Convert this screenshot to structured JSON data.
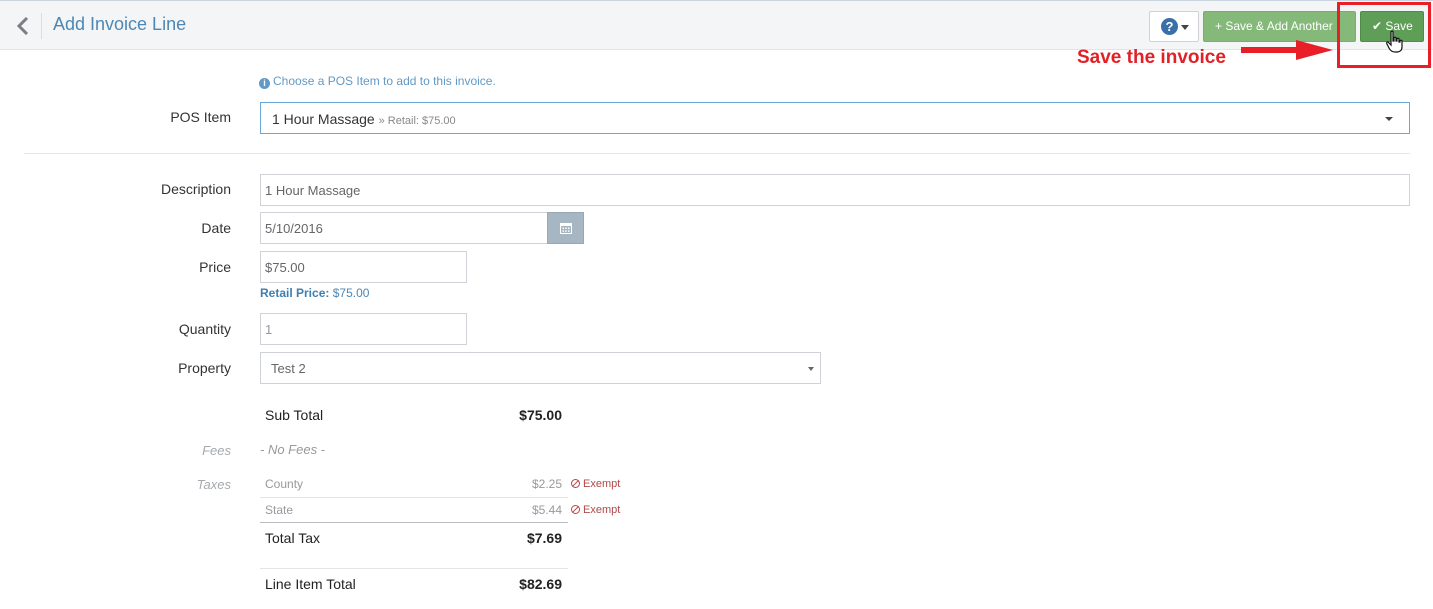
{
  "header": {
    "title": "Add Invoice Line",
    "help_icon": "question-circle-icon",
    "save_add_label": "+ Save & Add Another",
    "save_label": "✔ Save"
  },
  "annotation": {
    "text": "Save the invoice",
    "color": "#e81f27"
  },
  "form": {
    "info_text": "Choose a POS Item to add to this invoice.",
    "pos_item": {
      "label": "POS Item",
      "value": "1 Hour Massage",
      "retail_suffix": "» Retail: $75.00"
    },
    "description": {
      "label": "Description",
      "value": "1 Hour Massage"
    },
    "date": {
      "label": "Date",
      "value": "5/10/2016"
    },
    "price": {
      "label": "Price",
      "value": "$75.00",
      "retail_label": "Retail Price:",
      "retail_value": "$75.00"
    },
    "quantity": {
      "label": "Quantity",
      "value": "1"
    },
    "property": {
      "label": "Property",
      "value": "Test 2"
    }
  },
  "summary": {
    "subtotal_label": "Sub Total",
    "subtotal_value": "$75.00",
    "fees_label": "Fees",
    "fees_value": "- No Fees -",
    "taxes_label": "Taxes",
    "taxes": [
      {
        "name": "County",
        "amount": "$2.25",
        "status": "Exempt"
      },
      {
        "name": "State",
        "amount": "$5.44",
        "status": "Exempt"
      }
    ],
    "total_tax_label": "Total Tax",
    "total_tax_value": "$7.69",
    "line_total_label": "Line Item Total",
    "line_total_value": "$82.69"
  },
  "colors": {
    "accent": "#4d87b3",
    "save_green": "#5f9e56",
    "save_add_green": "#85b97a",
    "exempt_red": "#b14848"
  }
}
